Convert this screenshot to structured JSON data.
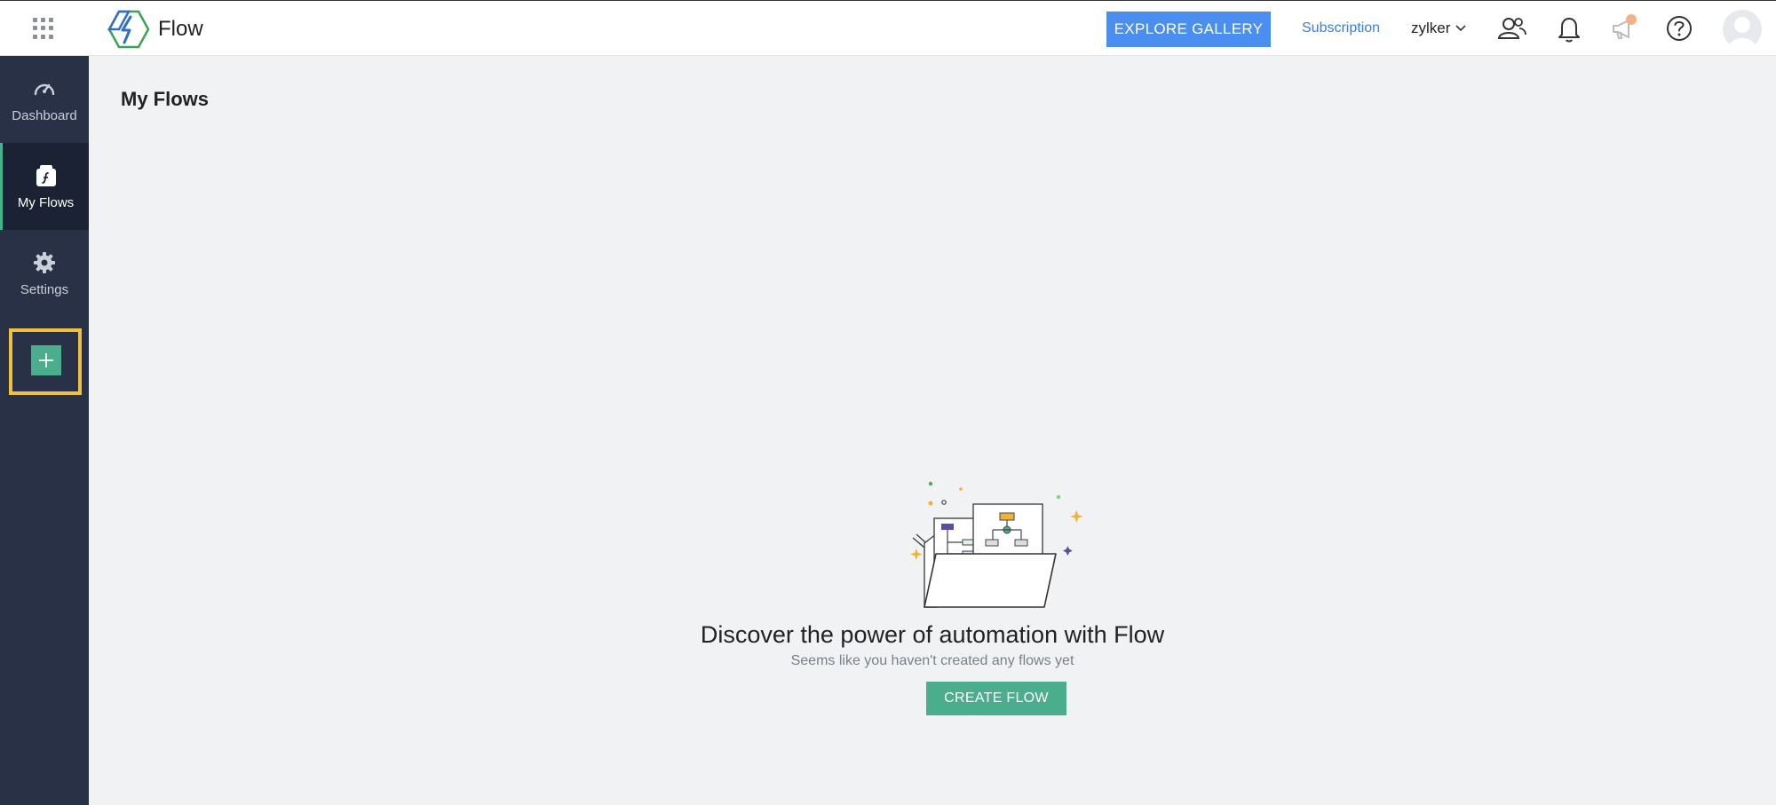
{
  "header": {
    "brand": "Flow",
    "explore_label": "EXPLORE GALLERY",
    "subscription_label": "Subscription",
    "org_name": "zylker"
  },
  "sidebar": {
    "items": [
      {
        "label": "Dashboard",
        "icon": "dashboard-gauge-icon"
      },
      {
        "label": "My Flows",
        "icon": "flows-icon"
      },
      {
        "label": "Settings",
        "icon": "gear-icon"
      }
    ],
    "active": "My Flows",
    "add_icon": "plus-icon"
  },
  "main": {
    "title": "My Flows",
    "empty_state": {
      "heading": "Discover the power of automation with Flow",
      "subtext": "Seems like you haven't created any flows yet",
      "button_label": "CREATE FLOW"
    }
  },
  "colors": {
    "accent_blue": "#4a8ff0",
    "accent_green": "#4aae8c",
    "sidebar_bg": "#283145",
    "highlight": "#f0c040"
  }
}
